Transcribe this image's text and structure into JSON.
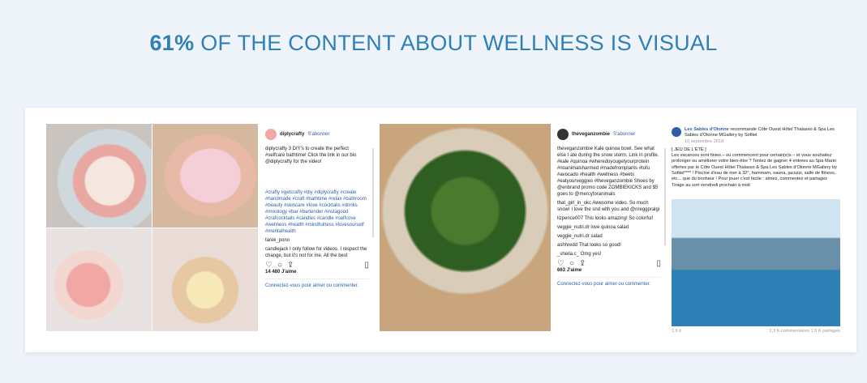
{
  "headline": {
    "percent": "61%",
    "text": " OF THE CONTENT ABOUT WELLNESS IS VISUAL"
  },
  "colors": {
    "accent": "#2f7fb8",
    "background": "#eef4f9"
  },
  "post1": {
    "username": "diplycrafty",
    "follow": "S'abonner",
    "caption": "diplycrafty 3 DIY's to create the perfect #selfcare bathtime! Click the link in our bio @diplycrafty for the video!",
    "hashtags": "#crafty #getcrafty #diy #diplycrafty #create #handmade #craft #bathtime #relax #bathroom #beauty #skincare #love #cocktails #drinks #mixology #bar #bartender #instagood #crafcocktails #candles #candle #selfcove #wellness #health #mindfulness #lovesourself #mentalhealth",
    "comment1": "tarek_pono",
    "comment2": "candiejack I only follow for videos. I respect the change, but it's not for me. All the best",
    "likes": "14 480 J'aime",
    "comment_prompt": "Connectez-vous pour aimer ou commenter."
  },
  "post2": {
    "username": "theveganzombie",
    "follow": "S'abonner",
    "caption": "theveganzombie Kale quinoa bowl. See what else I ate during the snow storm. Link in profile. #kale #quinoa #wheredoyougetyourprotein #noanimalsharmed #madefromplants #tofu #avocado #health #wellness #beets #eatyourveggies #theveganzombie Shoes by @enbrand promo code ZOMBIEKICKS and $5 goes to @mercyforanimals",
    "c1": "that_girl_in_okc Awesome video. So much snow! I love the snd with you and @nreggpralgi",
    "c2": "lizpence007 This looks amazing! So colorful!",
    "c3": "veggie_nutri.dr love quinoa salad",
    "c4": "veggie_nutri.dr salad",
    "c5": "ashhredd That looks so good!",
    "c6": "_sheila.c_ Omg yes!",
    "likes": "663 J'aime",
    "comment_prompt": "Connectez-vous pour aimer ou commenter."
  },
  "post3": {
    "page": "Les Sables d'Olonne",
    "recommends": "recommande Côte Ouest Hôtel Thalasso & Spa Les Sables d'Olonne MGallery by Sofitel",
    "date": "10 septembre 2018",
    "title": "[ JEU DE L'ÉTÉ ]",
    "body": "Les vacances sont finies – ou commencent pour certain(e)s – et vous souhaitez prolonger ou améliorer votre bien-être ? Tentez de gagner 4 entrées au Spa Marin offertes par le Côte Ouest Hôtel Thalasso & Spa Les Sables d'Olonne MGallery by Sofitel**** ! Piscine d'eau de mer à 32°, hammam, sauna, jacuzzi, salle de fitness, etc... que du bonheur ! Pour jouer c'est facile : aimez, commentez et partagez",
    "draw": "Tirage au sort vendredi prochain à midi",
    "reactions": "1,6 k",
    "stats": "2,3 K commentaires  1,6 K partages"
  }
}
